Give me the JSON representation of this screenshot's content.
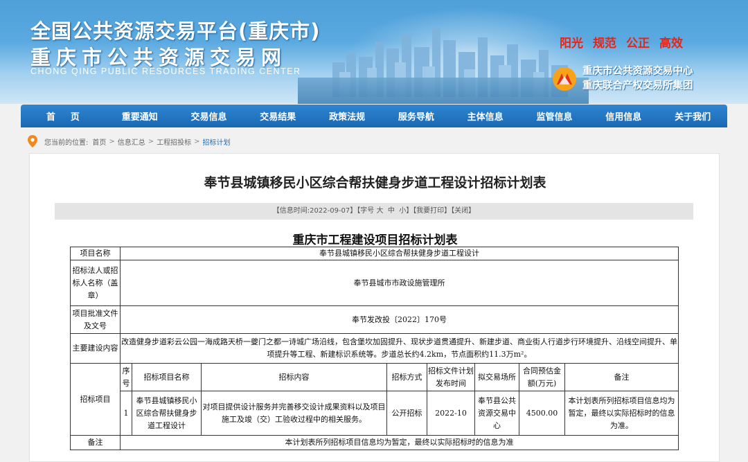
{
  "header": {
    "title_line1": "全国公共资源交易平台(重庆市)",
    "title_line2": "重庆市公共资源交易网",
    "title_en": "CHONG QING PUBLIC RESOURCES TRADING CENTER",
    "slogans": [
      "阳光",
      "规范",
      "公正",
      "高效"
    ],
    "org_name1": "重庆市公共资源交易中心",
    "org_name2": "重庆联合产权交易所集团",
    "slogan_color": "#e32619"
  },
  "nav": {
    "items": [
      "首页",
      "重要通知",
      "交易信息",
      "交易结果",
      "政策法规",
      "服务导航",
      "主体信息",
      "监管信息",
      "信用信息",
      "关于我们"
    ]
  },
  "breadcrumb": {
    "prefix": "您当前的位置:",
    "items": [
      "首页",
      "信息汇总",
      "工程招投标",
      "招标计划"
    ]
  },
  "article": {
    "title": "奉节县城镇移民小区综合帮扶健身步道工程设计招标计划表",
    "info": {
      "time": "【信息时间:2022-09-07】",
      "font_prefix": "【字号 ",
      "font_large": "大",
      "font_medium": "中",
      "font_small": "小",
      "font_suffix": "】",
      "print": "【我要打印】",
      "close": "【关闭】"
    },
    "table_title": "重庆市工程建设项目招标计划表",
    "table": {
      "project_name_label": "项目名称",
      "project_name": "奉节县城镇移民小区综合帮扶健身步道工程设计",
      "tenderer_label": "招标法人或招标人名称（盖章）",
      "tenderer": "奉节县城市市政设施管理所",
      "approval_label": "项目批准文件及文号",
      "approval": "奉节发改投〔2022〕170号",
      "content_label": "主要建设内容",
      "content": "改造健身步道彩云公园一海成路天桥一夔门之都一诗城广场沿线，包含堡坎加固提升、现状步道贯通提升、新建步道、商业街人行道步行环境提升、沿线空间提升、单项提升等工程、新建标识系统等。步道总长约4.2km，节点面积约11.3万m²。",
      "items_label": "招标项目",
      "headers": [
        "序号",
        "招标项目名称",
        "招标内容",
        "招标方式",
        "招标文件计划发布时间",
        "拟交易场所",
        "合同预估金额(万元)",
        "备注"
      ],
      "row": {
        "no": "1",
        "name": "奉节县城镇移民小区综合帮扶健身步道工程设计",
        "content": "对项目提供设计服务并完善移交设计成果资料以及项目施工及竣（交）工验收过程中的相关服务。",
        "method": "公开招标",
        "publish_time": "2022-10",
        "venue": "奉节县公共资源交易中心",
        "amount": "4500.00",
        "remark": "本计划表所列招标项目信息均为暂定，最终以实际招标时的信息为准。"
      },
      "remark_label": "备注",
      "remark": "本计划表所列招标项目信息均为暂定，最终以实际招标时的信息为准"
    }
  }
}
